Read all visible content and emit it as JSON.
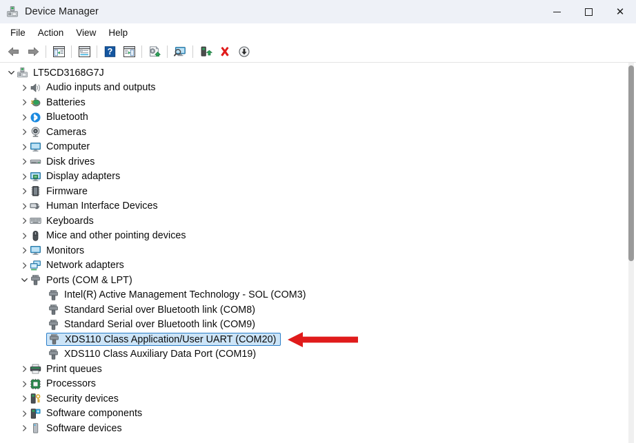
{
  "window": {
    "title": "Device Manager",
    "app_icon": "device-manager-icon",
    "controls": {
      "minimize": "—",
      "maximize": "☐",
      "close": "✕"
    }
  },
  "menubar": {
    "items": [
      {
        "label": "File",
        "name": "menu-file"
      },
      {
        "label": "Action",
        "name": "menu-action"
      },
      {
        "label": "View",
        "name": "menu-view"
      },
      {
        "label": "Help",
        "name": "menu-help"
      }
    ]
  },
  "toolbar": {
    "buttons": [
      {
        "name": "back-button",
        "icon": "back-arrow-icon",
        "tooltip": "Back"
      },
      {
        "name": "forward-button",
        "icon": "forward-arrow-icon",
        "tooltip": "Forward"
      },
      {
        "name": "separator-1",
        "icon": "separator",
        "tooltip": ""
      },
      {
        "name": "show-hide-console-tree-button",
        "icon": "console-tree-icon",
        "tooltip": "Show/Hide Console Tree"
      },
      {
        "name": "separator-2",
        "icon": "separator",
        "tooltip": ""
      },
      {
        "name": "properties-button",
        "icon": "properties-icon",
        "tooltip": "Properties"
      },
      {
        "name": "separator-3",
        "icon": "separator",
        "tooltip": ""
      },
      {
        "name": "help-button",
        "icon": "help-question-icon",
        "tooltip": "Help"
      },
      {
        "name": "show-hide-action-pane-button",
        "icon": "action-pane-icon",
        "tooltip": "Show/Hide Action Pane"
      },
      {
        "name": "separator-4",
        "icon": "separator",
        "tooltip": ""
      },
      {
        "name": "update-driver-button",
        "icon": "update-driver-icon",
        "tooltip": "Update Driver Software"
      },
      {
        "name": "separator-5",
        "icon": "separator",
        "tooltip": ""
      },
      {
        "name": "scan-for-hardware-changes-button",
        "icon": "scan-monitor-icon",
        "tooltip": "Scan for hardware changes"
      },
      {
        "name": "separator-6",
        "icon": "separator",
        "tooltip": ""
      },
      {
        "name": "enable-device-button",
        "icon": "enable-device-icon",
        "tooltip": "Enable device"
      },
      {
        "name": "uninstall-device-button",
        "icon": "red-x-icon",
        "tooltip": "Uninstall device"
      },
      {
        "name": "disable-device-button",
        "icon": "disable-device-down-arrow-icon",
        "tooltip": "Disable device"
      }
    ]
  },
  "tree": {
    "root": {
      "label": "LT5CD3168G7J",
      "icon": "computer-node-icon",
      "expanded": true,
      "level": 0
    },
    "nodes": [
      {
        "label": "Audio inputs and outputs",
        "icon": "speaker-icon",
        "expanded": false,
        "level": 1,
        "selected": false
      },
      {
        "label": "Batteries",
        "icon": "battery-icon",
        "expanded": false,
        "level": 1,
        "selected": false
      },
      {
        "label": "Bluetooth",
        "icon": "bluetooth-icon",
        "expanded": false,
        "level": 1,
        "selected": false
      },
      {
        "label": "Cameras",
        "icon": "camera-icon",
        "expanded": false,
        "level": 1,
        "selected": false
      },
      {
        "label": "Computer",
        "icon": "computer-monitor-icon",
        "expanded": false,
        "level": 1,
        "selected": false
      },
      {
        "label": "Disk drives",
        "icon": "disk-drive-icon",
        "expanded": false,
        "level": 1,
        "selected": false
      },
      {
        "label": "Display adapters",
        "icon": "display-adapter-icon",
        "expanded": false,
        "level": 1,
        "selected": false
      },
      {
        "label": "Firmware",
        "icon": "firmware-chip-icon",
        "expanded": false,
        "level": 1,
        "selected": false
      },
      {
        "label": "Human Interface Devices",
        "icon": "hid-gamepad-icon",
        "expanded": false,
        "level": 1,
        "selected": false
      },
      {
        "label": "Keyboards",
        "icon": "keyboard-icon",
        "expanded": false,
        "level": 1,
        "selected": false
      },
      {
        "label": "Mice and other pointing devices",
        "icon": "mouse-icon",
        "expanded": false,
        "level": 1,
        "selected": false
      },
      {
        "label": "Monitors",
        "icon": "monitor-icon",
        "expanded": false,
        "level": 1,
        "selected": false
      },
      {
        "label": "Network adapters",
        "icon": "network-adapter-icon",
        "expanded": false,
        "level": 1,
        "selected": false
      },
      {
        "label": "Ports (COM & LPT)",
        "icon": "port-connector-icon",
        "expanded": true,
        "level": 1,
        "selected": false
      },
      {
        "label": "Intel(R) Active Management Technology - SOL (COM3)",
        "icon": "port-connector-icon",
        "expanded": null,
        "level": 2,
        "selected": false
      },
      {
        "label": "Standard Serial over Bluetooth link (COM8)",
        "icon": "port-connector-icon",
        "expanded": null,
        "level": 2,
        "selected": false
      },
      {
        "label": "Standard Serial over Bluetooth link (COM9)",
        "icon": "port-connector-icon",
        "expanded": null,
        "level": 2,
        "selected": false
      },
      {
        "label": "XDS110 Class Application/User UART (COM20)",
        "icon": "port-connector-icon",
        "expanded": null,
        "level": 2,
        "selected": true
      },
      {
        "label": "XDS110 Class Auxiliary Data Port (COM19)",
        "icon": "port-connector-icon",
        "expanded": null,
        "level": 2,
        "selected": false
      },
      {
        "label": "Print queues",
        "icon": "printer-icon",
        "expanded": false,
        "level": 1,
        "selected": false
      },
      {
        "label": "Processors",
        "icon": "processor-icon",
        "expanded": false,
        "level": 1,
        "selected": false
      },
      {
        "label": "Security devices",
        "icon": "security-key-icon",
        "expanded": false,
        "level": 1,
        "selected": false
      },
      {
        "label": "Software components",
        "icon": "software-component-icon",
        "expanded": false,
        "level": 1,
        "selected": false
      },
      {
        "label": "Software devices",
        "icon": "software-device-icon",
        "expanded": false,
        "level": 1,
        "selected": false
      }
    ]
  },
  "annotation": {
    "arrow": {
      "name": "red-annotation-arrow",
      "color": "#e01b1b",
      "direction": "left",
      "points_to": "XDS110 Class Application/User UART (COM20)"
    }
  },
  "scrollbar": {
    "name": "vertical-scrollbar",
    "thumb_color": "#9a9a9a",
    "track_color": "#f0f0f0"
  },
  "colors": {
    "titlebar_bg": "#eef1f7",
    "selection_fill": "#cce4f7",
    "selection_border": "#2a7ec8",
    "text": "#0a0a0a",
    "accent_red": "#e01b1b"
  }
}
